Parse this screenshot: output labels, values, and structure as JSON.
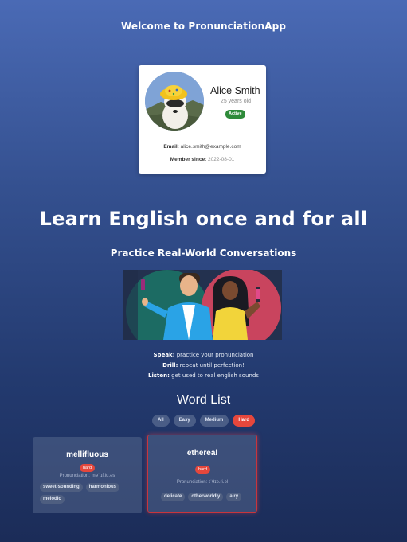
{
  "header": {
    "welcome": "Welcome to PronunciationApp"
  },
  "profile": {
    "name": "Alice Smith",
    "age": "25 years old",
    "status": "Active",
    "email_label": "Email:",
    "email": "alice.smith@example.com",
    "member_label": "Member since:",
    "member_since": "2022-08-01"
  },
  "hero": {
    "title": "Learn English once and for all",
    "subtitle": "Practice Real-World Conversations"
  },
  "features": [
    {
      "label": "Speak:",
      "text": "practice your pronunciation"
    },
    {
      "label": "Drill:",
      "text": "repeat until perfection!"
    },
    {
      "label": "Listen:",
      "text": "get used to real english sounds"
    }
  ],
  "word_list": {
    "title": "Word List",
    "filters": [
      "All",
      "Easy",
      "Medium",
      "Hard"
    ],
    "active_filter": "Hard",
    "cards": [
      {
        "word": "mellifluous",
        "difficulty": "hard",
        "pronunciation": "Pronunciation: məˈlɪf.lu.əs",
        "tags": [
          "sweet-sounding",
          "harmonious",
          "melodic"
        ]
      },
      {
        "word": "ethereal",
        "difficulty": "hard",
        "pronunciation": "Pronunciation: ɪˈθɪə.ri.əl",
        "tags": [
          "delicate",
          "otherworldly",
          "airy"
        ]
      }
    ]
  },
  "colors": {
    "accent_red": "#e5473c",
    "status_green": "#2e8b3a",
    "background_top": "#4a6ab5",
    "background_bottom": "#1b2c58"
  }
}
